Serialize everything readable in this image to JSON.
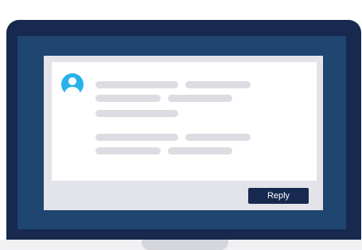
{
  "comment": {
    "reply_label": "Reply"
  },
  "icons": {
    "avatar": "user-avatar-icon"
  },
  "colors": {
    "monitor_frame": "#17294f",
    "screen": "#1f4571",
    "avatar": "#29b2ea",
    "placeholder_line": "#dcdde2",
    "reply_button": "#17294f"
  }
}
